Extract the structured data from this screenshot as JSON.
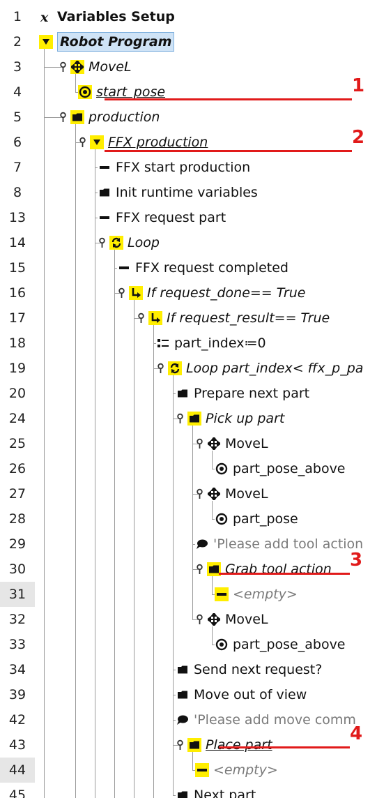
{
  "tree": {
    "rows": [
      {
        "line": "1",
        "label": "Variables Setup",
        "icon": "variables-x-icon",
        "indent": 0,
        "style": "bold",
        "toggle": false,
        "highlight_line": false
      },
      {
        "line": "2",
        "label": "Robot Program",
        "icon": "program-triangle-icon",
        "indent": 0,
        "style": "selected",
        "toggle": false,
        "highlight_line": false
      },
      {
        "line": "3",
        "label": "MoveL",
        "icon": "move-cross-icon",
        "indent": 1,
        "style": "italic",
        "toggle": true,
        "iconYellow": true,
        "highlight_line": false
      },
      {
        "line": "4",
        "label": "start_pose",
        "icon": "waypoint-target-icon",
        "indent": 2,
        "style": "italic-underline",
        "toggle": false,
        "iconYellow": true,
        "highlight_line": false
      },
      {
        "line": "5",
        "label": "production",
        "icon": "folder-icon",
        "indent": 1,
        "style": "italic",
        "toggle": true,
        "iconYellow": true,
        "highlight_line": false
      },
      {
        "line": "6",
        "label": "FFX production",
        "icon": "program-triangle-icon",
        "indent": 2,
        "style": "italic-underline",
        "toggle": true,
        "iconYellow": true,
        "highlight_line": false
      },
      {
        "line": "7",
        "label": "FFX start production",
        "icon": "subprogram-dash-icon",
        "indent": 3,
        "style": "normal",
        "toggle": false,
        "highlight_line": false
      },
      {
        "line": "8",
        "label": "Init runtime variables",
        "icon": "folder-icon",
        "indent": 3,
        "style": "normal",
        "toggle": false,
        "highlight_line": false
      },
      {
        "line": "13",
        "label": "FFX request part",
        "icon": "subprogram-dash-icon",
        "indent": 3,
        "style": "normal",
        "toggle": false,
        "highlight_line": false
      },
      {
        "line": "14",
        "label": "Loop",
        "icon": "loop-icon",
        "indent": 3,
        "style": "italic",
        "toggle": true,
        "iconYellow": true,
        "highlight_line": false
      },
      {
        "line": "15",
        "label": "FFX request completed",
        "icon": "subprogram-dash-icon",
        "indent": 4,
        "style": "normal",
        "toggle": false,
        "highlight_line": false
      },
      {
        "line": "16",
        "label": "If request_done== True",
        "icon": "if-branch-icon",
        "indent": 4,
        "style": "italic",
        "toggle": true,
        "iconYellow": true,
        "highlight_line": false
      },
      {
        "line": "17",
        "label": "If request_result== True",
        "icon": "if-branch-icon",
        "indent": 5,
        "style": "italic",
        "toggle": true,
        "iconYellow": true,
        "highlight_line": false
      },
      {
        "line": "18",
        "label": "part_index≔0",
        "icon": "assignment-icon",
        "indent": 6,
        "style": "normal",
        "toggle": false,
        "highlight_line": false
      },
      {
        "line": "19",
        "label": "Loop part_index< ffx_p_pa",
        "icon": "loop-icon",
        "indent": 6,
        "style": "italic",
        "toggle": true,
        "iconYellow": true,
        "highlight_line": false
      },
      {
        "line": "20",
        "label": "Prepare next part",
        "icon": "folder-icon",
        "indent": 7,
        "style": "normal",
        "toggle": false,
        "highlight_line": false
      },
      {
        "line": "24",
        "label": "Pick up part",
        "icon": "folder-icon",
        "indent": 7,
        "style": "italic",
        "toggle": true,
        "iconYellow": true,
        "highlight_line": false
      },
      {
        "line": "25",
        "label": "MoveL",
        "icon": "move-cross-icon",
        "indent": 8,
        "style": "normal",
        "toggle": true,
        "highlight_line": false
      },
      {
        "line": "26",
        "label": "part_pose_above",
        "icon": "waypoint-target-icon",
        "indent": 9,
        "style": "normal",
        "toggle": false,
        "highlight_line": false
      },
      {
        "line": "27",
        "label": "MoveL",
        "icon": "move-cross-icon",
        "indent": 8,
        "style": "normal",
        "toggle": true,
        "highlight_line": false
      },
      {
        "line": "28",
        "label": "part_pose",
        "icon": "waypoint-target-icon",
        "indent": 9,
        "style": "normal",
        "toggle": false,
        "highlight_line": false
      },
      {
        "line": "29",
        "label": "'Please add tool action",
        "icon": "comment-bubble-icon",
        "indent": 8,
        "style": "disabled",
        "toggle": false,
        "highlight_line": false
      },
      {
        "line": "30",
        "label": "Grab tool action",
        "icon": "folder-icon",
        "indent": 8,
        "style": "italic-underline",
        "toggle": true,
        "iconYellow": true,
        "highlight_line": false
      },
      {
        "line": "31",
        "label": "<empty>",
        "icon": "empty-placeholder-icon",
        "indent": 9,
        "style": "disabled-italic",
        "toggle": false,
        "iconYellow": true,
        "highlight_line": true
      },
      {
        "line": "32",
        "label": "MoveL",
        "icon": "move-cross-icon",
        "indent": 8,
        "style": "normal",
        "toggle": true,
        "highlight_line": false
      },
      {
        "line": "33",
        "label": "part_pose_above",
        "icon": "waypoint-target-icon",
        "indent": 9,
        "style": "normal",
        "toggle": false,
        "highlight_line": false
      },
      {
        "line": "34",
        "label": "Send next request?",
        "icon": "folder-icon",
        "indent": 7,
        "style": "normal",
        "toggle": false,
        "highlight_line": false
      },
      {
        "line": "39",
        "label": "Move out of view",
        "icon": "folder-icon",
        "indent": 7,
        "style": "normal",
        "toggle": false,
        "highlight_line": false
      },
      {
        "line": "42",
        "label": "'Please add move comm",
        "icon": "comment-bubble-icon",
        "indent": 7,
        "style": "disabled",
        "toggle": false,
        "highlight_line": false
      },
      {
        "line": "43",
        "label": "Place part",
        "icon": "folder-icon",
        "indent": 7,
        "style": "italic-underline",
        "toggle": true,
        "iconYellow": true,
        "highlight_line": false
      },
      {
        "line": "44",
        "label": "<empty>",
        "icon": "empty-placeholder-icon",
        "indent": 8,
        "style": "disabled-italic",
        "toggle": false,
        "iconYellow": true,
        "highlight_line": true
      },
      {
        "line": "45",
        "label": "Next part",
        "icon": "folder-icon",
        "indent": 7,
        "style": "normal",
        "toggle": false,
        "highlight_line": false
      }
    ]
  },
  "annotations": [
    {
      "label": "1",
      "row": 3
    },
    {
      "label": "2",
      "row": 5
    },
    {
      "label": "3",
      "row": 22
    },
    {
      "label": "4",
      "row": 29
    }
  ],
  "colors": {
    "annotation_red": "#e11a1a",
    "node_yellow": "#ffee00",
    "selected_bg": "#cfe3f6",
    "line_highlight": "#e6e6e6"
  }
}
